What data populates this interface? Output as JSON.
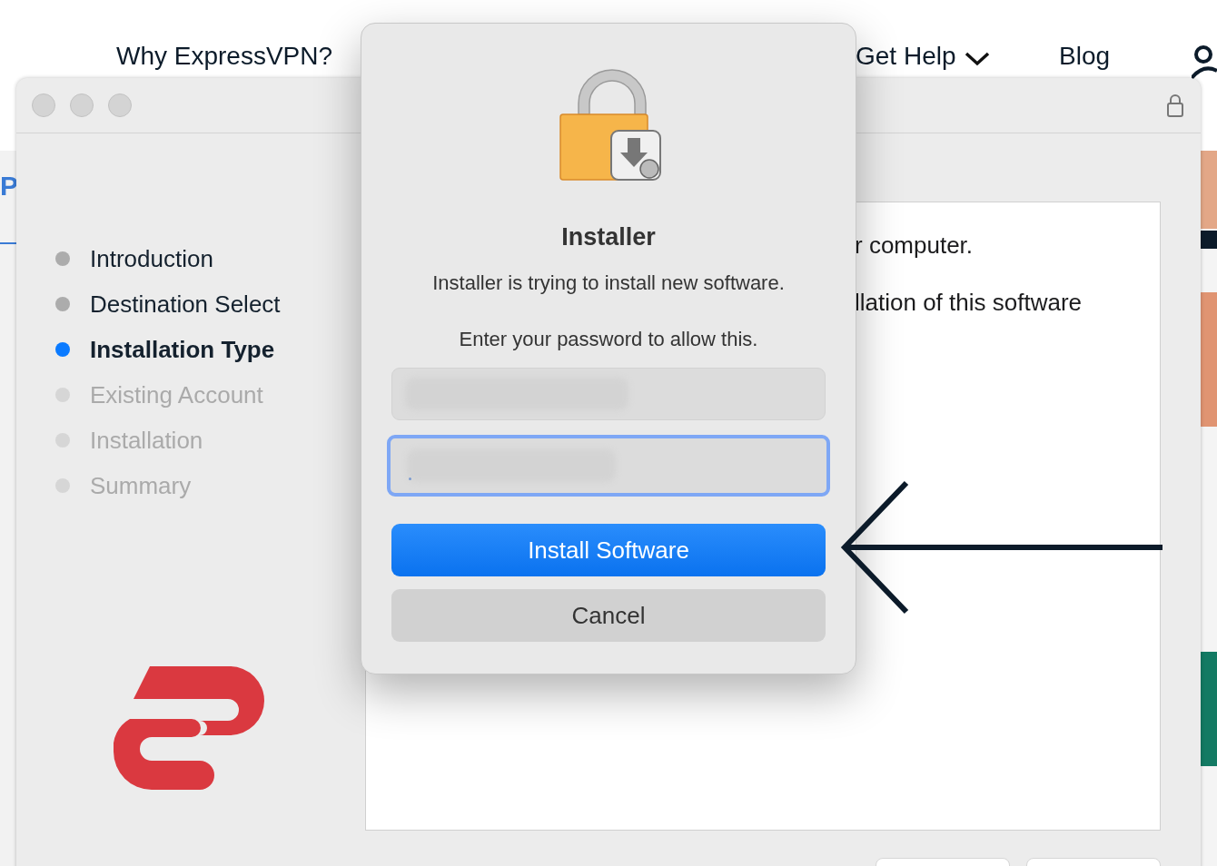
{
  "background_page": {
    "nav": [
      {
        "label": "Why ExpressVPN?",
        "dropdown": false
      },
      {
        "label": "Get Help",
        "dropdown": true
      },
      {
        "label": "Blog",
        "dropdown": false
      }
    ],
    "left_fragment": "P"
  },
  "installer": {
    "steps": [
      {
        "label": "Introduction",
        "selected": false,
        "completed": true
      },
      {
        "label": "Destination Select",
        "selected": false,
        "completed": true
      },
      {
        "label": "Installation Type",
        "selected": true,
        "completed": false
      },
      {
        "label": "Existing Account",
        "selected": false,
        "completed": false
      },
      {
        "label": "Installation",
        "selected": false,
        "completed": false
      },
      {
        "label": "Summary",
        "selected": false,
        "completed": false
      }
    ],
    "content_lines": [
      "r computer.",
      "llation of this software"
    ]
  },
  "dialog": {
    "title": "Installer",
    "message": "Installer is trying to install new software.",
    "prompt": "Enter your password to allow this.",
    "fields": [
      {
        "kind": "text",
        "focused": false
      },
      {
        "kind": "password",
        "focused": true
      }
    ],
    "buttons": [
      {
        "label": "Install Software",
        "default": true
      },
      {
        "label": "Cancel",
        "default": false
      }
    ]
  }
}
